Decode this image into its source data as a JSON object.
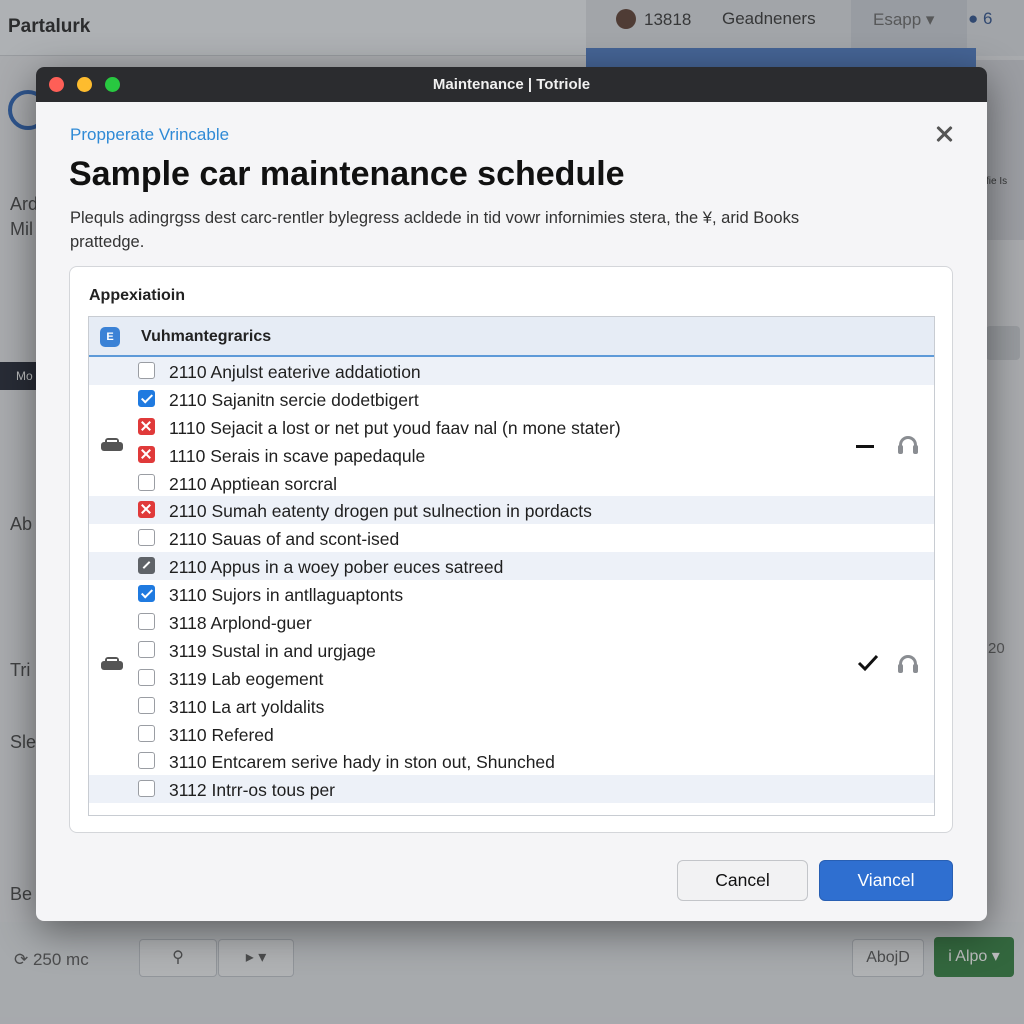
{
  "background": {
    "brand": "Partalurk",
    "stats": [
      {
        "value": "13818"
      },
      {
        "value": "Geadneners"
      }
    ],
    "select_label": "Esapp",
    "user_count": "6",
    "right_panel_label": "fie Is",
    "sidebar_texts": [
      "Ard",
      "Mil",
      "Mo",
      "Ab",
      "Tri",
      "Sle",
      "Be"
    ],
    "right_number": "20",
    "bottom_label": "250 mc",
    "bottom_btn_right": "AbojD",
    "green_btn": "i Alpo"
  },
  "window": {
    "title": "Maintenance | Totriole"
  },
  "dialog": {
    "eyebrow": "Propperate Vrincable",
    "title": "Sample car maintenance schedule",
    "description": "Plequls adingrgss dest carc-rentler bylegress acldede in tid vowr infornimies stera, the ¥, arid Books prattedge.",
    "panel_label": "Appexiatioin",
    "table_header": "Vuhmantegrarics",
    "table_header_icon": "E",
    "rows": [
      {
        "text": "2110 Anjulst eaterive addatiotion",
        "state": "unchecked",
        "alt": true
      },
      {
        "text": "2110 Sajanitn sercie dodetbigert",
        "state": "checked",
        "alt": false
      },
      {
        "text": "1110 Sejacit a lost or net put youd faav nal (n mone stater)",
        "state": "error",
        "alt": false
      },
      {
        "text": "1110 Serais in scave papedaqule",
        "state": "error",
        "alt": false
      },
      {
        "text": "2110 Apptiean sorcral",
        "state": "unchecked",
        "alt": false
      },
      {
        "text": "2110 Sumah eatenty drogen put sulnection in pordacts",
        "state": "error",
        "alt": true
      },
      {
        "text": "2110 Sauas of and scont-ised",
        "state": "unchecked",
        "alt": false
      },
      {
        "text": "2110 Appus in a woey pober euces satreed",
        "state": "partial",
        "alt": true
      },
      {
        "text": "3110 Sujors in antllaguaptonts",
        "state": "checked",
        "alt": false
      },
      {
        "text": "3118 Arplond-guer",
        "state": "unchecked",
        "alt": false
      },
      {
        "text": "3119 Sustal in and urgjage",
        "state": "unchecked",
        "alt": false
      },
      {
        "text": "3119 Lab eogement",
        "state": "unchecked",
        "alt": false
      },
      {
        "text": "3110 La art yoldalits",
        "state": "unchecked",
        "alt": false
      },
      {
        "text": "3110 Refered",
        "state": "unchecked",
        "alt": false
      },
      {
        "text": "3110 Entcarem serive hady in ston out, Shunched",
        "state": "unchecked",
        "alt": false
      },
      {
        "text": "3112 Intrr-os tous per",
        "state": "unchecked",
        "alt": true
      }
    ],
    "groups": [
      {
        "icon": "car-icon",
        "status": "minus",
        "action_icon": "headset-icon"
      },
      {
        "icon": "car-icon",
        "status": "check",
        "action_icon": "headset-icon"
      }
    ],
    "cancel_label": "Cancel",
    "primary_label": "Viancel"
  },
  "colors": {
    "accent": "#2f6fd0",
    "eyebrow": "#2f8ad6",
    "checked": "#1f7ae0",
    "error": "#e03a3a",
    "titlebar": "#2b2c2f"
  }
}
